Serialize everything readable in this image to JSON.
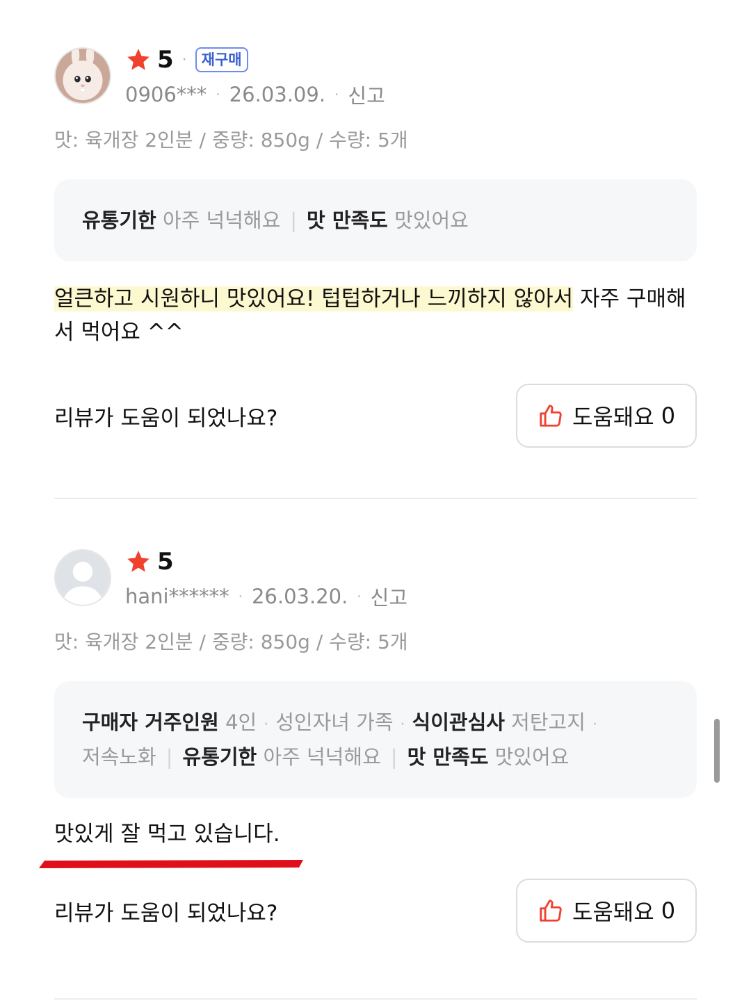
{
  "reviews": [
    {
      "avatar_icon": "rabbit-avatar-icon",
      "rating": "5",
      "badge": "재구매",
      "user": "0906***",
      "date": "26.03.09.",
      "report": "신고",
      "options": "맛: 육개장 2인분 / 중량: 850g / 수량: 5개",
      "summary": [
        {
          "key": "유통기한",
          "value": "아주 넉넉해요"
        },
        {
          "key": "맛 만족도",
          "value": "맛있어요"
        }
      ],
      "body_highlight": "얼큰하고 시원하니 맛있어요! 텁텁하거나 느끼하지 않아서",
      "body_rest": " 자주 구매해서 먹어요 ^^",
      "helpful_question": "리뷰가 도움이 되었나요?",
      "helpful_label": "도움돼요",
      "helpful_count": "0"
    },
    {
      "avatar_icon": "default-user-avatar-icon",
      "rating": "5",
      "user": "hani******",
      "date": "26.03.20.",
      "report": "신고",
      "options": "맛: 육개장 2인분 / 중량: 850g / 수량: 5개",
      "summary": {
        "household_key": "구매자 거주인원",
        "household_values": [
          "4인",
          "성인자녀 가족"
        ],
        "diet_key": "식이관심사",
        "diet_values": [
          "저탄고지",
          "저속노화"
        ],
        "expiry_key": "유통기한",
        "expiry_value": "아주 넉넉해요",
        "taste_key": "맛 만족도",
        "taste_value": "맛있어요"
      },
      "body": "맛있게 잘 먹고 있습니다.",
      "helpful_question": "리뷰가 도움이 되었나요?",
      "helpful_label": "도움돼요",
      "helpful_count": "0"
    }
  ],
  "colors": {
    "star": "#f0402e",
    "thumb": "#f0402e",
    "badge": "#3a5fd0",
    "highlight": "#fcf8cf",
    "underline_annotation": "#e0101a"
  }
}
